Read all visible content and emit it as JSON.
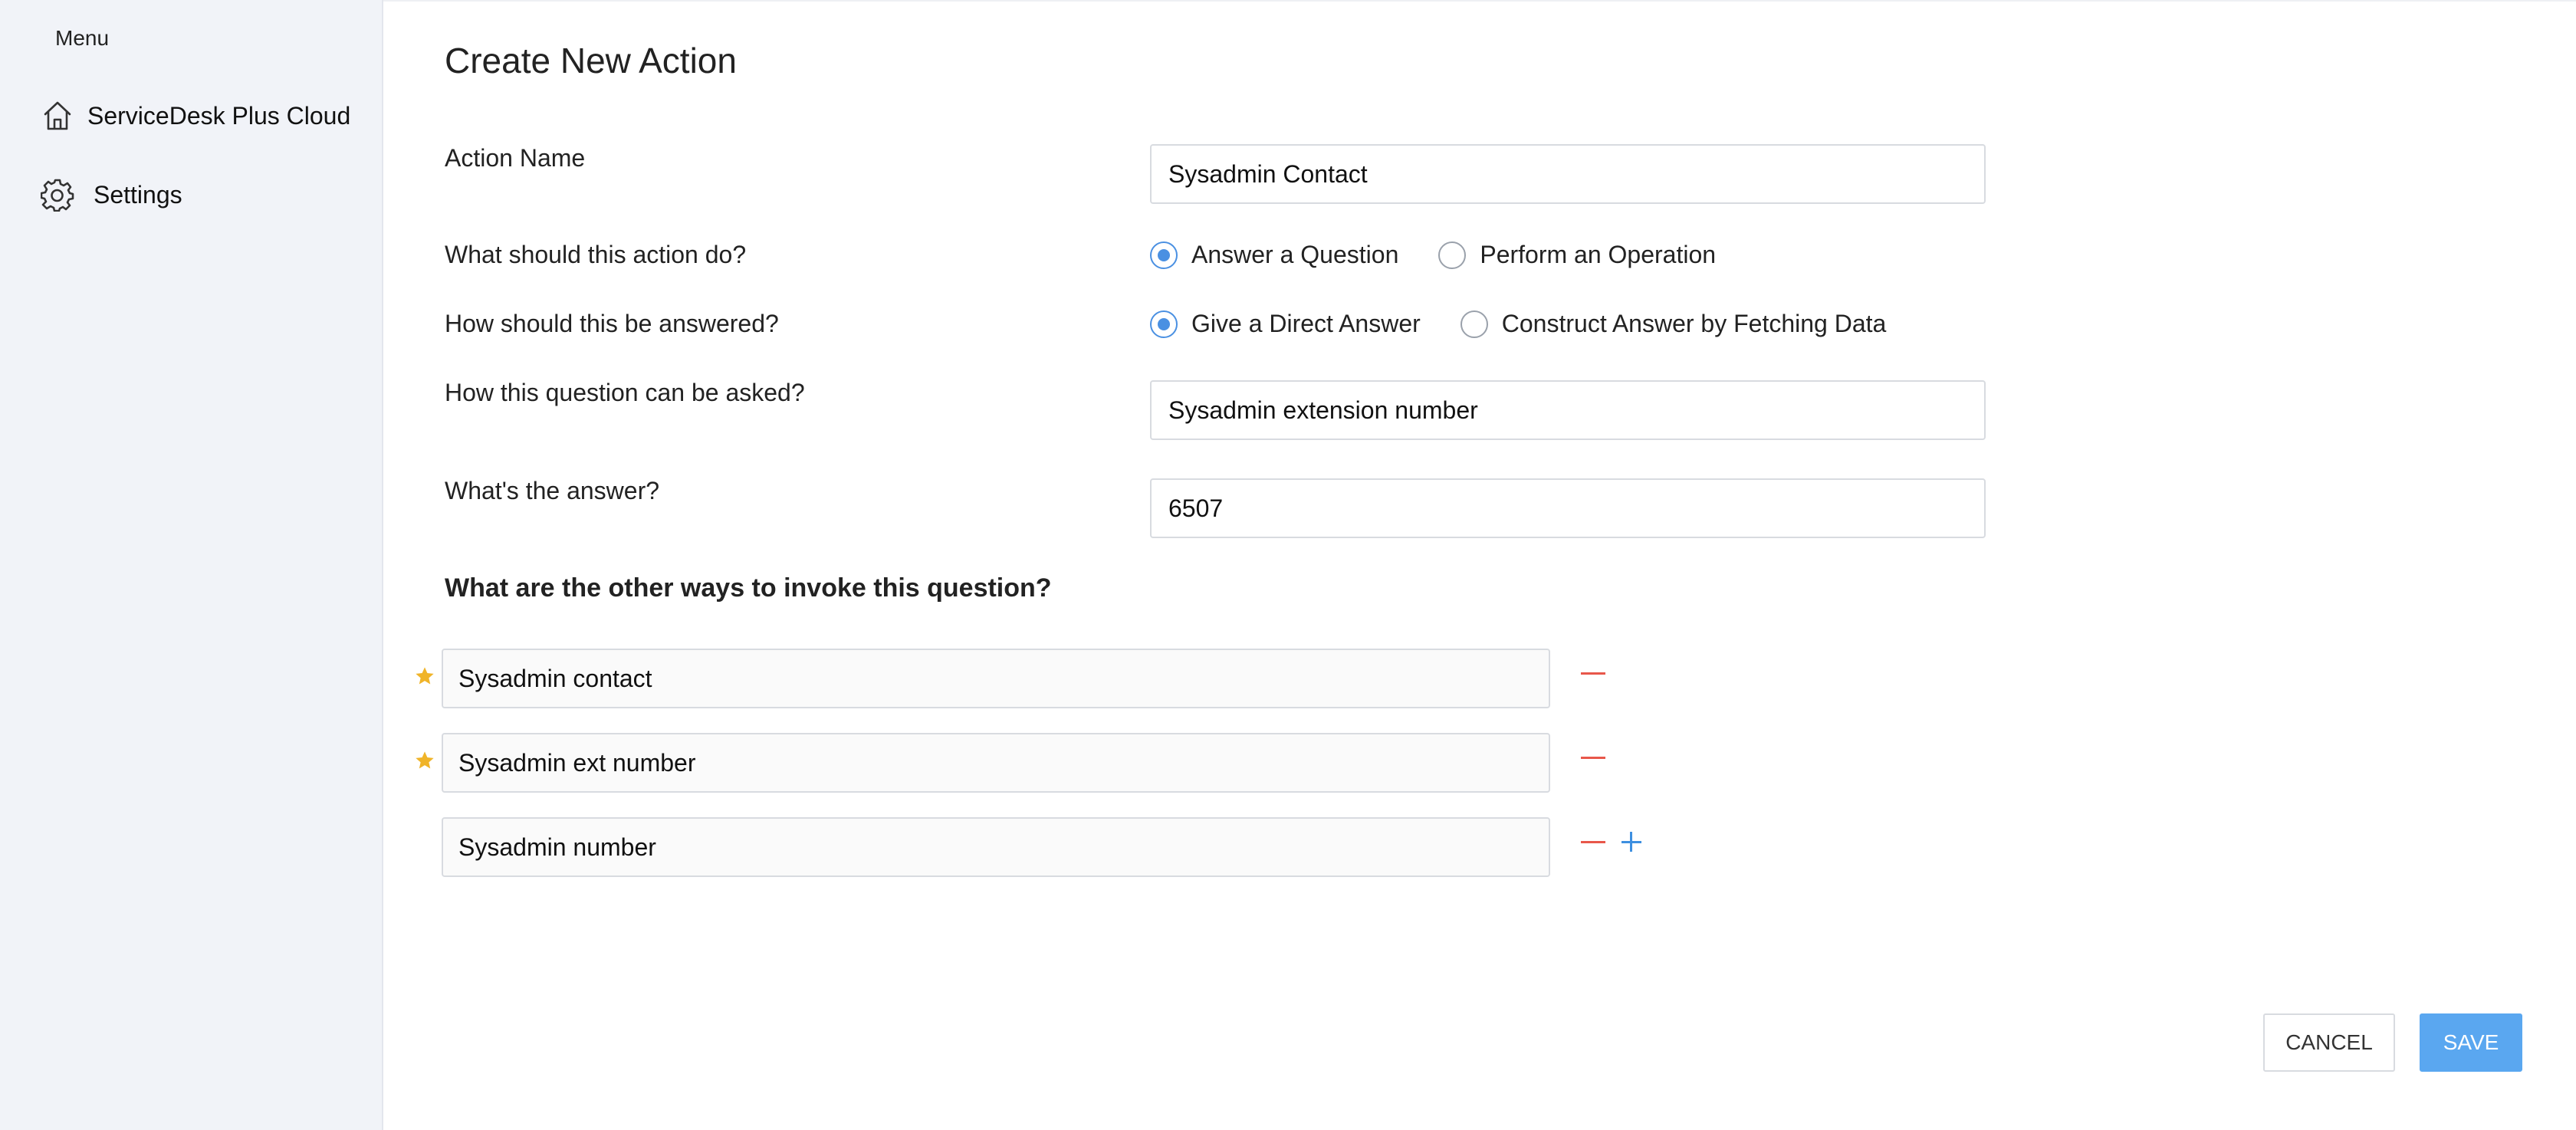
{
  "sidebar": {
    "menu_title": "Menu",
    "items": [
      {
        "label": "ServiceDesk Plus Cloud",
        "icon": "home-icon"
      },
      {
        "label": "Settings",
        "icon": "gear-icon"
      }
    ]
  },
  "form": {
    "title": "Create New Action",
    "action_name": {
      "label": "Action Name",
      "value": "Sysadmin Contact"
    },
    "action_type": {
      "label": "What should this action do?",
      "options": [
        "Answer a Question",
        "Perform an Operation"
      ],
      "selected": "Answer a Question"
    },
    "answer_type": {
      "label": "How should this be answered?",
      "options": [
        "Give a Direct Answer",
        "Construct Answer by Fetching Data"
      ],
      "selected": "Give a Direct Answer"
    },
    "question": {
      "label": "How this question can be asked?",
      "value": "Sysadmin extension number"
    },
    "answer": {
      "label": "What's the answer?",
      "value": "6507"
    },
    "alternatives": {
      "heading": "What are the other ways to invoke this question?",
      "items": [
        {
          "value": "Sysadmin contact",
          "starred": true
        },
        {
          "value": "Sysadmin ext number",
          "starred": true
        },
        {
          "value": "Sysadmin number",
          "starred": false
        }
      ]
    }
  },
  "buttons": {
    "cancel": "CANCEL",
    "save": "SAVE"
  },
  "colors": {
    "sidebar_bg": "#f1f3f8",
    "accent": "#4a90e2",
    "save_button": "#5aa7f0",
    "remove": "#e8574a",
    "add": "#3d8fe0",
    "star": "#f0b429"
  }
}
